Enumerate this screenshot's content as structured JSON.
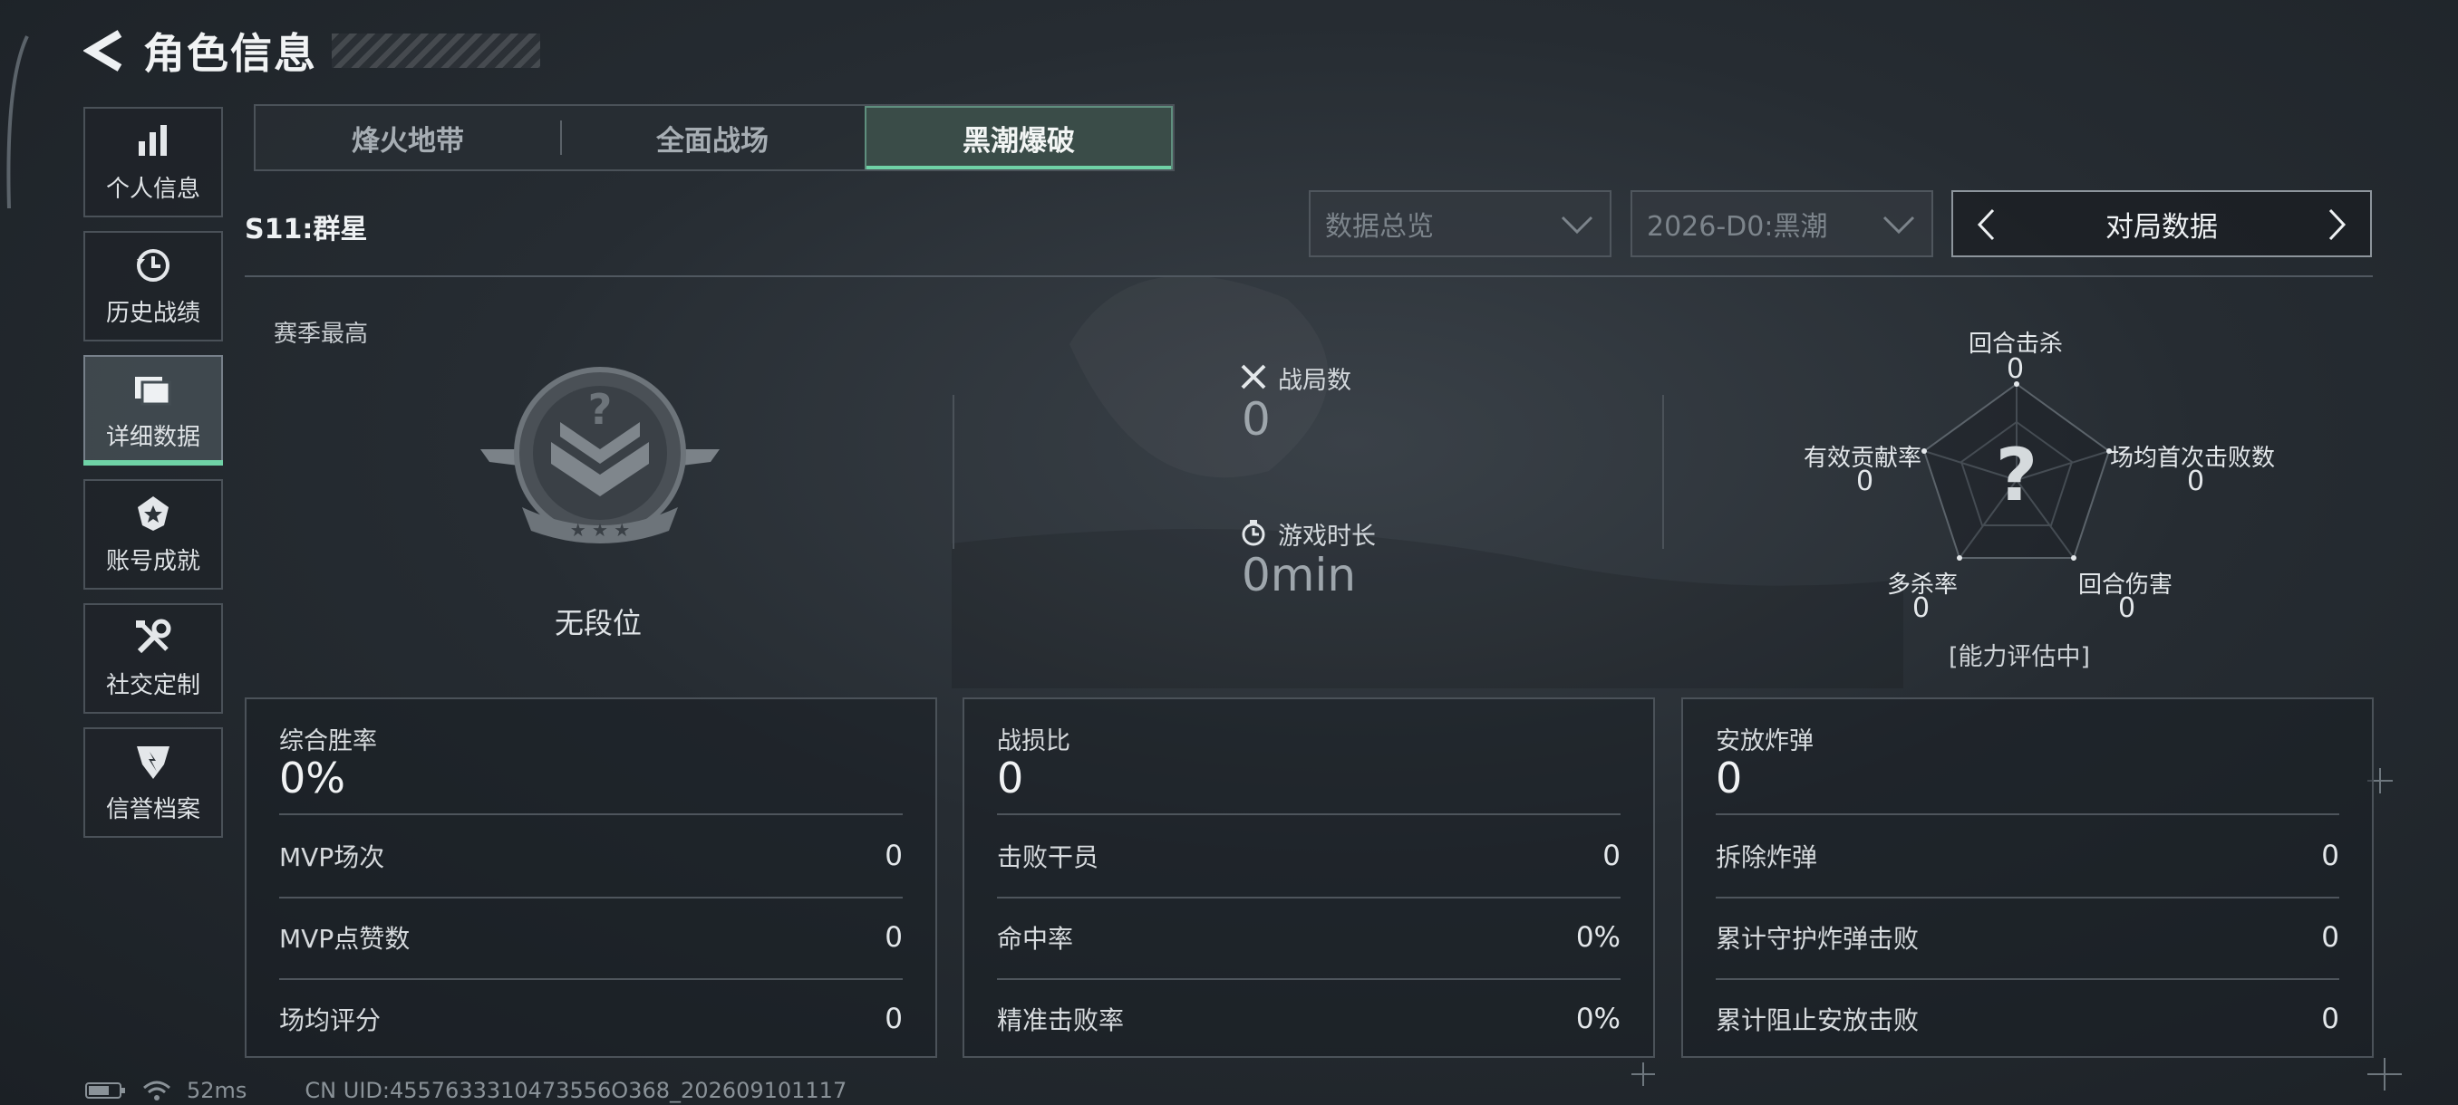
{
  "header": {
    "title": "角色信息"
  },
  "sidebar": {
    "items": [
      {
        "label": "个人信息",
        "icon": "bar-chart-icon"
      },
      {
        "label": "历史战绩",
        "icon": "history-clock-icon"
      },
      {
        "label": "详细数据",
        "icon": "cards-icon",
        "active": true
      },
      {
        "label": "账号成就",
        "icon": "achievement-badge-icon"
      },
      {
        "label": "社交定制",
        "icon": "tools-icon"
      },
      {
        "label": "信誉档案",
        "icon": "reputation-shield-icon"
      }
    ]
  },
  "tabs": [
    {
      "label": "烽火地带"
    },
    {
      "label": "全面战场"
    },
    {
      "label": "黑潮爆破",
      "active": true
    }
  ],
  "season": "S11:群星",
  "filters": {
    "overview": "数据总览",
    "mode": "2026-D0:黑潮"
  },
  "nav": {
    "label": "对局数据"
  },
  "rank": {
    "caption": "赛季最高",
    "name": "无段位"
  },
  "summary": {
    "matches": {
      "label": "战局数",
      "value": "0"
    },
    "playtime": {
      "label": "游戏时长",
      "value": "0min"
    }
  },
  "radar": {
    "axes": [
      {
        "label": "回合击杀",
        "value": "0"
      },
      {
        "label": "场均首次击败数",
        "value": "0"
      },
      {
        "label": "回合伤害",
        "value": "0"
      },
      {
        "label": "多杀率",
        "value": "0"
      },
      {
        "label": "有效贡献率",
        "value": "0"
      }
    ],
    "center_mark": "?",
    "status": "[能力评估中]"
  },
  "cards": [
    {
      "title": "综合胜率",
      "value": "0%",
      "rows": [
        {
          "label": "MVP场次",
          "value": "0"
        },
        {
          "label": "MVP点赞数",
          "value": "0"
        },
        {
          "label": "场均评分",
          "value": "0"
        }
      ]
    },
    {
      "title": "战损比",
      "value": "0",
      "rows": [
        {
          "label": "击败干员",
          "value": "0"
        },
        {
          "label": "命中率",
          "value": "0%"
        },
        {
          "label": "精准击败率",
          "value": "0%"
        }
      ]
    },
    {
      "title": "安放炸弹",
      "value": "0",
      "rows": [
        {
          "label": "拆除炸弹",
          "value": "0"
        },
        {
          "label": "累计守护炸弹击败",
          "value": "0"
        },
        {
          "label": "累计阻止安放击败",
          "value": "0"
        }
      ]
    }
  ],
  "footer": {
    "ping": "52ms",
    "uid": "CN UID:4557633310473556O368_202609101117"
  },
  "colors": {
    "accent": "#6fd2a6",
    "panel_border": "#4b5259"
  }
}
